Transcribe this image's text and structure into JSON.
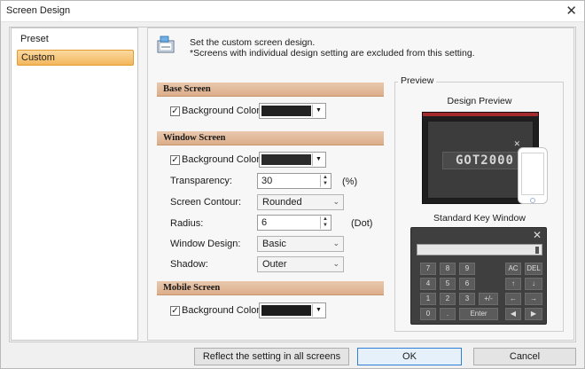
{
  "window": {
    "title": "Screen Design"
  },
  "sidebar": {
    "items": [
      {
        "label": "Preset"
      },
      {
        "label": "Custom"
      }
    ]
  },
  "header": {
    "line1": "Set the custom screen design.",
    "line2": "*Screens with individual design setting are excluded from this setting."
  },
  "base_screen": {
    "title": "Base Screen",
    "bg_label": "Background Color:",
    "bg_checked": true,
    "bg_color": "#222222"
  },
  "window_screen": {
    "title": "Window Screen",
    "bg_label": "Background Color:",
    "bg_checked": true,
    "bg_color": "#2b2b2b",
    "transparency_label": "Transparency:",
    "transparency_value": "30",
    "transparency_unit": "(%)",
    "contour_label": "Screen Contour:",
    "contour_value": "Rounded",
    "radius_label": "Radius:",
    "radius_value": "6",
    "radius_unit": "(Dot)",
    "design_label": "Window Design:",
    "design_value": "Basic",
    "shadow_label": "Shadow:",
    "shadow_value": "Outer"
  },
  "mobile_screen": {
    "title": "Mobile Screen",
    "bg_label": "Background Color:",
    "bg_checked": true,
    "bg_color": "#1c1c1c"
  },
  "preview": {
    "legend": "Preview",
    "design_title": "Design Preview",
    "logo_text": "GOT2000",
    "keywin_title": "Standard Key Window",
    "keys": [
      "7",
      "8",
      "9",
      "AC",
      "DEL",
      "4",
      "5",
      "6",
      "↑",
      "↓",
      "1",
      "2",
      "3",
      "+/-",
      "←",
      "→",
      "0",
      ".",
      "Enter",
      "◀",
      "▶"
    ]
  },
  "footer": {
    "reflect_label": "Reflect the setting in all screens",
    "ok_label": "OK",
    "cancel_label": "Cancel"
  }
}
